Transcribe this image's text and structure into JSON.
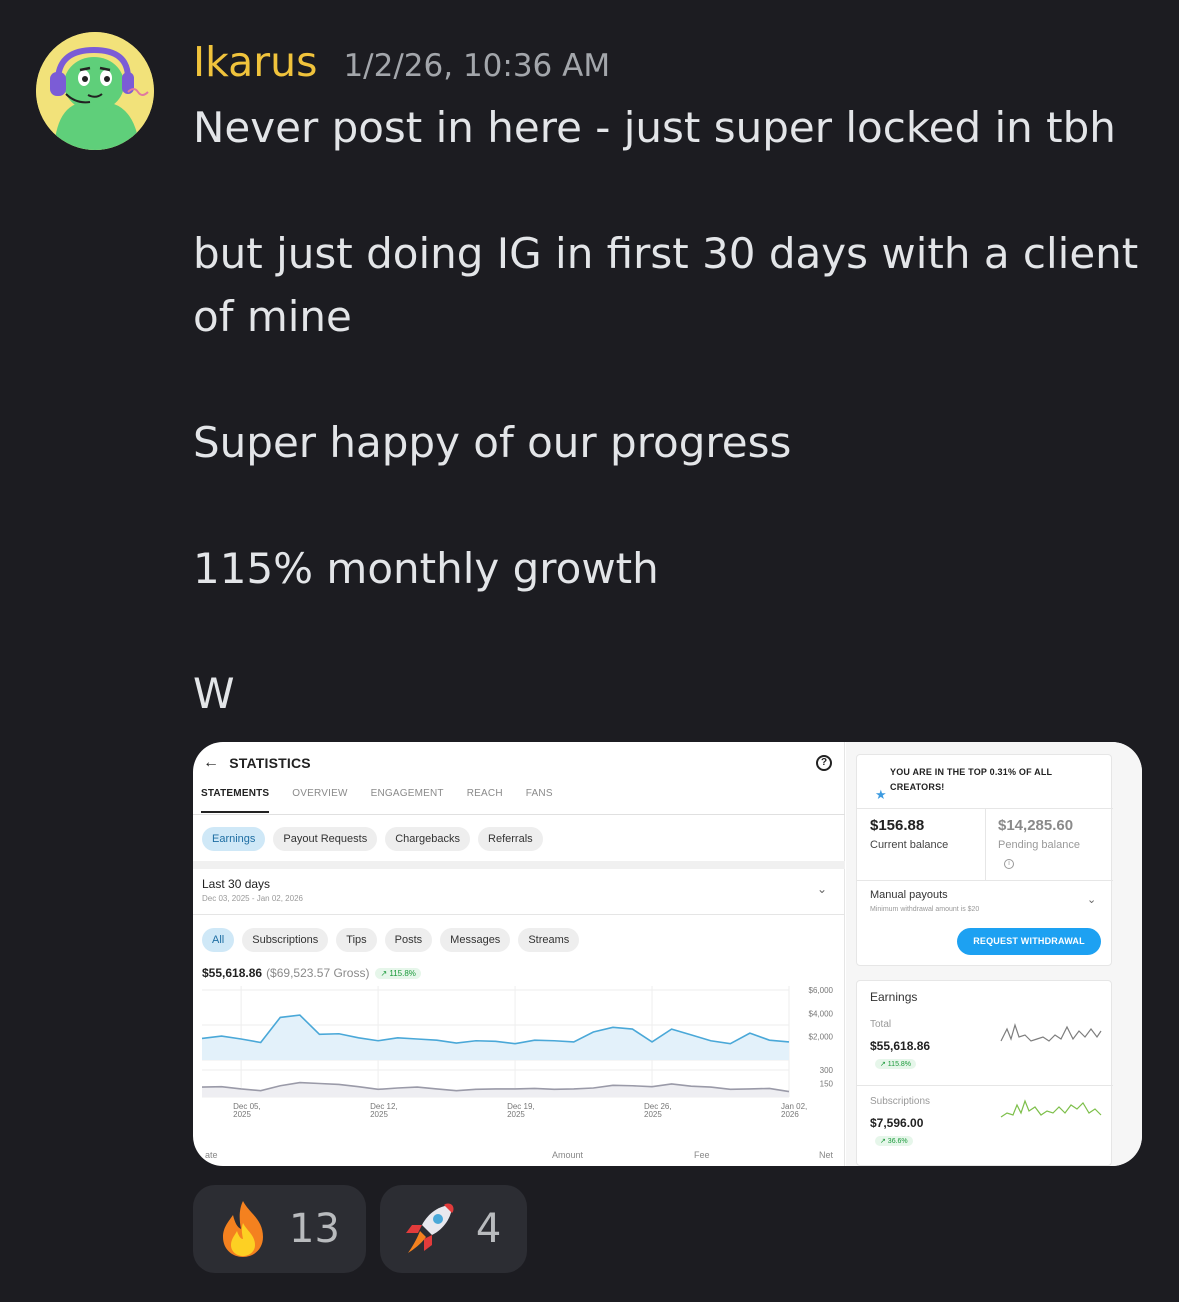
{
  "message": {
    "username": "Ikarus",
    "timestamp": "1/2/26, 10:36 AM",
    "lines": [
      "Never post in here - just super locked in tbh",
      "but just doing IG in first 30 days with a client",
      "of mine",
      "Super happy of our progress",
      "115% monthly growth",
      "W"
    ]
  },
  "attachment": {
    "title": "STATISTICS",
    "tabs": [
      "STATEMENTS",
      "OVERVIEW",
      "ENGAGEMENT",
      "REACH",
      "FANS"
    ],
    "sub_tabs": [
      "Earnings",
      "Payout Requests",
      "Chargebacks",
      "Referrals"
    ],
    "period": {
      "label": "Last 30 days",
      "range": "Dec 03, 2025 - Jan 02, 2026"
    },
    "filters": [
      "All",
      "Subscriptions",
      "Tips",
      "Posts",
      "Messages",
      "Streams"
    ],
    "total": {
      "net": "$55,618.86",
      "gross": "($69,523.57 Gross)",
      "growth": "↗ 115.8%"
    },
    "table_headers": {
      "date": "ate",
      "amount": "Amount",
      "fee": "Fee",
      "net": "Net"
    },
    "top_badge": "YOU ARE IN THE TOP 0.31% OF ALL CREATORS!",
    "current_balance": {
      "value": "$156.88",
      "label": "Current balance"
    },
    "pending_balance": {
      "value": "$14,285.60",
      "label": "Pending balance"
    },
    "payouts": {
      "label": "Manual payouts",
      "min": "Minimum withdrawal amount is $20",
      "button": "REQUEST WITHDRAWAL"
    },
    "earnings_card": {
      "title": "Earnings",
      "total_label": "Total",
      "total_value": "$55,618.86",
      "total_growth": "↗ 115.8%",
      "subs_label": "Subscriptions",
      "subs_value": "$7,596.00",
      "subs_growth": "↗ 36.6%"
    }
  },
  "chart_data": {
    "type": "area",
    "x": [
      "Dec 03",
      "Dec 04",
      "Dec 05",
      "Dec 06",
      "Dec 07",
      "Dec 08",
      "Dec 09",
      "Dec 10",
      "Dec 11",
      "Dec 12",
      "Dec 13",
      "Dec 14",
      "Dec 15",
      "Dec 16",
      "Dec 17",
      "Dec 18",
      "Dec 19",
      "Dec 20",
      "Dec 21",
      "Dec 22",
      "Dec 23",
      "Dec 24",
      "Dec 25",
      "Dec 26",
      "Dec 27",
      "Dec 28",
      "Dec 29",
      "Dec 30",
      "Dec 31",
      "Jan 01",
      "Jan 02"
    ],
    "x_ticks": [
      "Dec 05,\n2025",
      "Dec 12,\n2025",
      "Dec 19,\n2025",
      "Dec 26,\n2025",
      "Jan 02,\n2026"
    ],
    "x_tick_labels": [
      {
        "line1": "Dec 05,",
        "line2": "2025",
        "index": 2
      },
      {
        "line1": "Dec 12,",
        "line2": "2025",
        "index": 9
      },
      {
        "line1": "Dec 19,",
        "line2": "2025",
        "index": 16
      },
      {
        "line1": "Dec 26,",
        "line2": "2025",
        "index": 23
      },
      {
        "line1": "Jan 02,",
        "line2": "2026",
        "index": 30
      }
    ],
    "series": [
      {
        "values": [
          1850,
          2050,
          1800,
          1500,
          3650,
          3850,
          2200,
          2250,
          1900,
          1650,
          1900,
          1800,
          1700,
          1450,
          1650,
          1600,
          1400,
          1700,
          1650,
          1550,
          2400,
          2800,
          2650,
          1550,
          2650,
          2150,
          1650,
          1400,
          2300,
          1700,
          1550
        ]
      },
      {
        "values": [
          110,
          115,
          90,
          70,
          125,
          160,
          150,
          140,
          115,
          85,
          100,
          110,
          90,
          70,
          85,
          90,
          90,
          95,
          85,
          90,
          100,
          130,
          125,
          115,
          145,
          120,
          110,
          85,
          90,
          95,
          60
        ]
      }
    ],
    "y_ticks_top": [
      "$6,000",
      "$4,000",
      "$2,000"
    ],
    "y_ticks_bottom": [
      "300",
      "150"
    ],
    "ylim_top": [
      0,
      6000
    ],
    "ylim_bottom": [
      0,
      300
    ],
    "grid": true,
    "colors": {
      "line1": "#4aa8d8",
      "fill1": "#e3f1fa",
      "line2": "#9a9aa8",
      "fill2": "#eeeef2"
    }
  },
  "reactions": [
    {
      "emoji": "fire-icon",
      "count": "13"
    },
    {
      "emoji": "rocket-icon",
      "count": "4"
    }
  ]
}
